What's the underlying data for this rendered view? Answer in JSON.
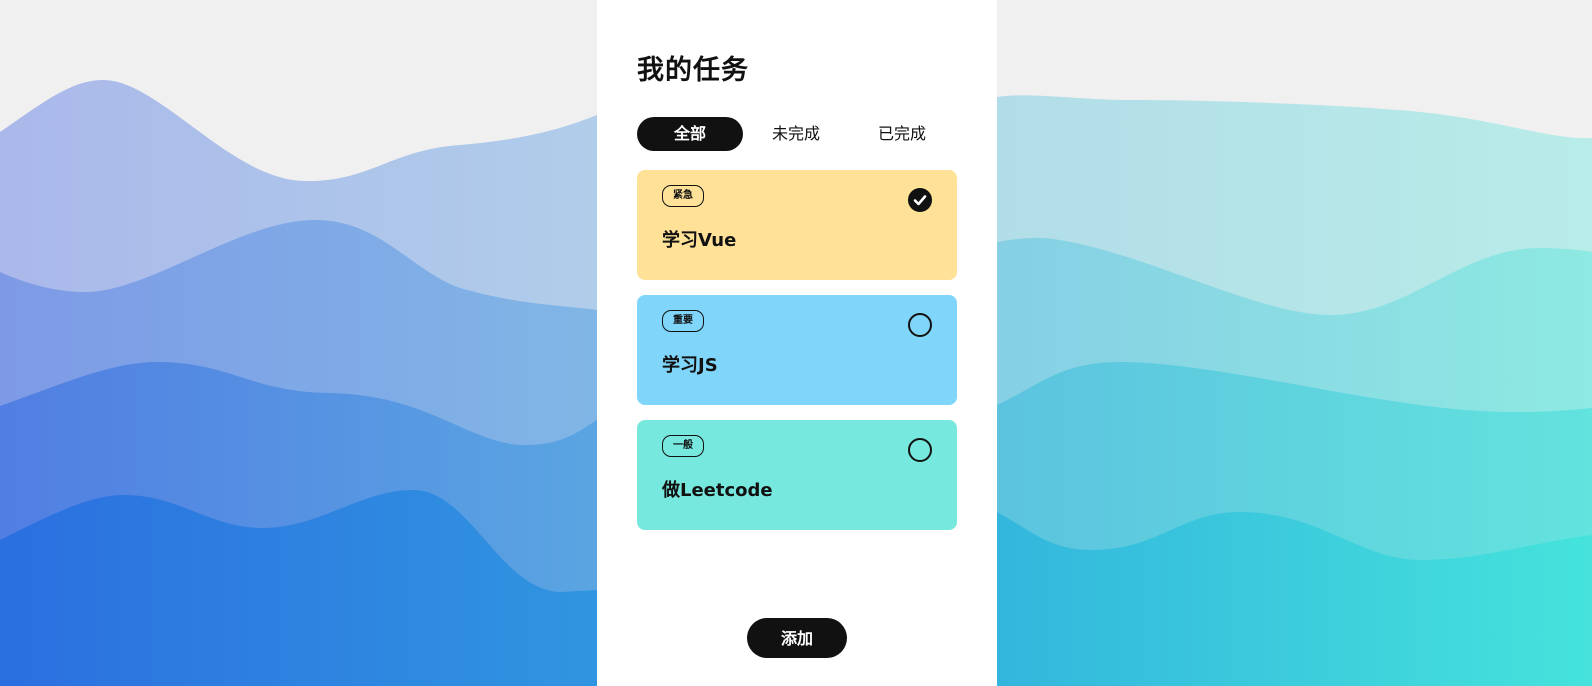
{
  "page": {
    "title": "我的任务"
  },
  "tabs": [
    {
      "label": "全部",
      "active": true
    },
    {
      "label": "未完成",
      "active": false
    },
    {
      "label": "已完成",
      "active": false
    }
  ],
  "tasks": [
    {
      "tag": "紧急",
      "title": "学习Vue",
      "done": true,
      "color": "#ffe298"
    },
    {
      "tag": "重要",
      "title": "学习JS",
      "done": false,
      "color": "#80d6fa"
    },
    {
      "tag": "一般",
      "title": "做Leetcode",
      "done": false,
      "color": "#77e8de"
    }
  ],
  "actions": {
    "add_label": "添加"
  },
  "colors": {
    "active_tab": "#111111",
    "panel": "#ffffff",
    "background": "#f0f0f0"
  }
}
